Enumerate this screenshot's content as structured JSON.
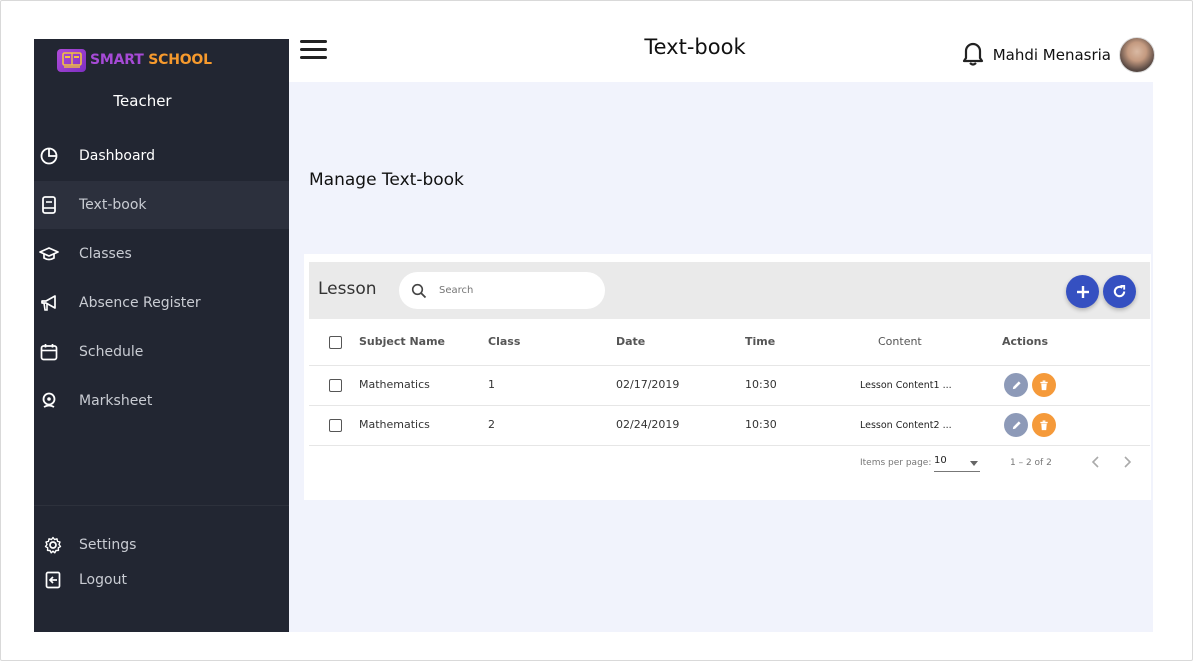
{
  "app": {
    "brand_part1": "SMART",
    "brand_part2": "SCHOOL"
  },
  "sidebar": {
    "role": "Teacher",
    "items": [
      {
        "label": "Dashboard",
        "icon": "pie-chart-icon"
      },
      {
        "label": "Text-book",
        "icon": "book-icon",
        "active": true
      },
      {
        "label": "Classes",
        "icon": "graduation-cap-icon"
      },
      {
        "label": "Absence Register",
        "icon": "megaphone-icon"
      },
      {
        "label": "Schedule",
        "icon": "calendar-icon"
      },
      {
        "label": "Marksheet",
        "icon": "marksheet-icon"
      }
    ],
    "bottom": [
      {
        "label": "Settings",
        "icon": "gear-icon"
      },
      {
        "label": "Logout",
        "icon": "logout-icon"
      }
    ]
  },
  "header": {
    "title": "Text-book",
    "user_name": "Mahdi Menasria"
  },
  "main": {
    "manage_title": "Manage Text-book",
    "card_title": "Lesson",
    "search_placeholder": "Search",
    "columns": {
      "subject": "Subject Name",
      "class": "Class",
      "date": "Date",
      "time": "Time",
      "content": "Content",
      "actions": "Actions"
    },
    "rows": [
      {
        "subject": "Mathematics",
        "class": "1",
        "date": "02/17/2019",
        "time": "10:30",
        "content": "Lesson Content1 ..."
      },
      {
        "subject": "Mathematics",
        "class": "2",
        "date": "02/24/2019",
        "time": "10:30",
        "content": "Lesson Content2 ..."
      }
    ],
    "paginator": {
      "items_per_page_label": "Items per page:",
      "items_per_page": "10",
      "range": "1 – 2 of 2"
    }
  },
  "colors": {
    "sidebar_bg": "#222632",
    "accent_blue": "#3550c1",
    "edit_gray": "#8d9ab8",
    "delete_orange": "#f59a3a",
    "brand_purple": "#a64ad6",
    "brand_orange": "#f79a2d"
  }
}
